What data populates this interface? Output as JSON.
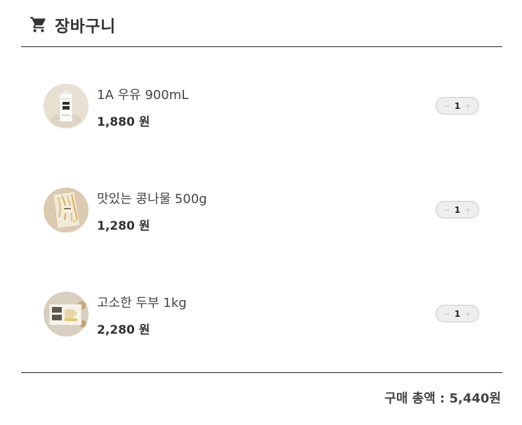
{
  "header": {
    "title": "장바구니",
    "icon": "cart-icon"
  },
  "items": [
    {
      "name": "1A 우유 900mL",
      "price": "1,880 원",
      "quantity": "1",
      "minus": "−",
      "plus": "+",
      "thumbnail": "milk-carton-image"
    },
    {
      "name": "맛있는 콩나물 500g",
      "price": "1,280 원",
      "quantity": "1",
      "minus": "−",
      "plus": "+",
      "thumbnail": "bean-sprouts-image"
    },
    {
      "name": "고소한 두부 1kg",
      "price": "2,280 원",
      "quantity": "1",
      "minus": "−",
      "plus": "+",
      "thumbnail": "tofu-package-image"
    }
  ],
  "summary": {
    "total_text": "구매 총액 : 5,440원"
  },
  "colors": {
    "text": "#333333",
    "divider": "#222222",
    "stepper_bg": "#eeeeee",
    "stepper_border": "#c9c9c9"
  }
}
